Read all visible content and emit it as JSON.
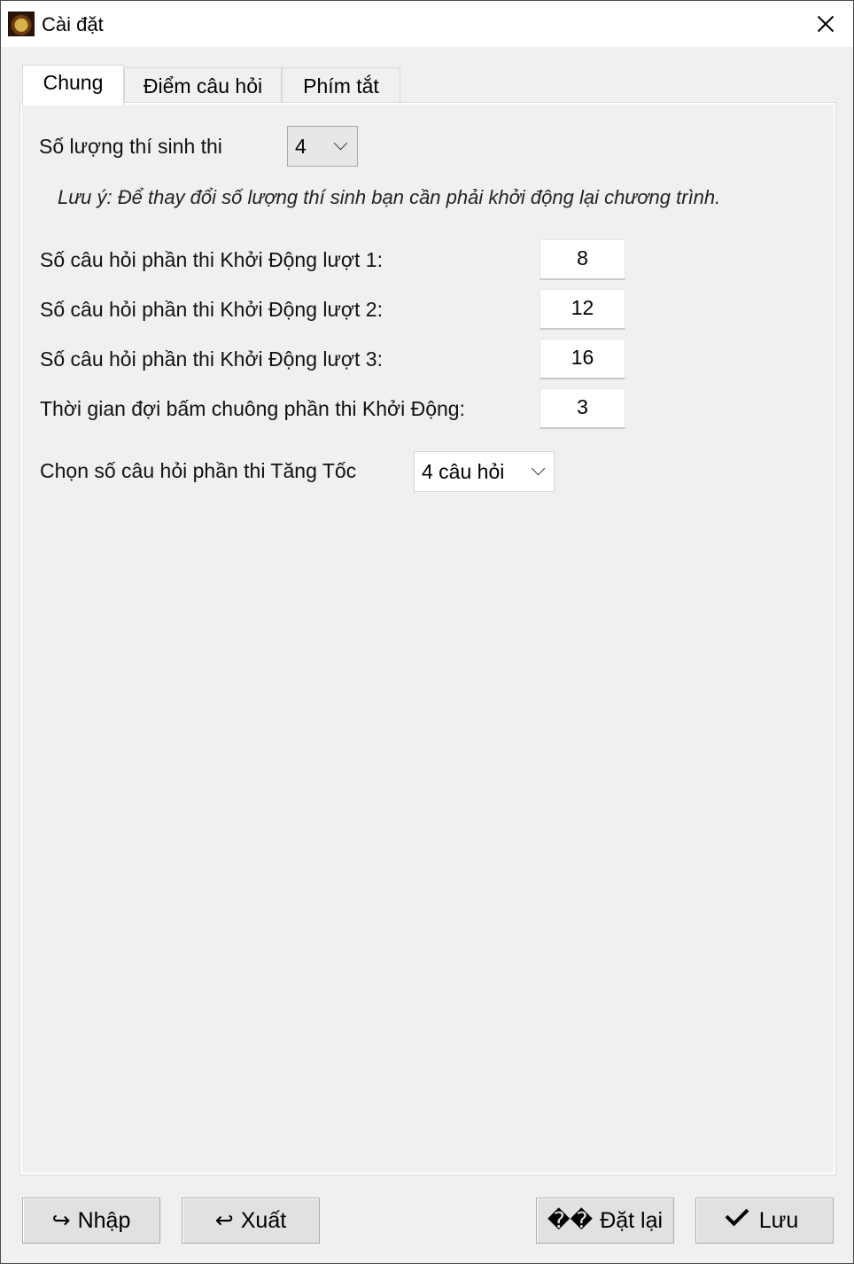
{
  "window": {
    "title": "Cài đặt"
  },
  "tabs": [
    {
      "label": "Chung",
      "active": true
    },
    {
      "label": "Điểm câu hỏi",
      "active": false
    },
    {
      "label": "Phím tắt",
      "active": false
    }
  ],
  "general": {
    "contestants_label": "Số lượng thí sinh thi",
    "contestants_value": "4",
    "note": "Lưu ý: Để thay đổi số lượng thí sinh bạn cần phải khởi động lại chương trình.",
    "fields": [
      {
        "label": "Số câu hỏi phần thi Khởi Động lượt 1:",
        "value": "8"
      },
      {
        "label": "Số câu hỏi phần thi Khởi Động lượt 2:",
        "value": "12"
      },
      {
        "label": "Số câu hỏi phần thi Khởi Động lượt 3:",
        "value": "16"
      },
      {
        "label": "Thời gian đợi bấm chuông phần thi Khởi Động:",
        "value": "3"
      }
    ],
    "acceleration_label": "Chọn số câu hỏi phần thi Tăng Tốc",
    "acceleration_value": "4 câu hỏi"
  },
  "footer": {
    "import_label": "Nhập",
    "import_icon": "↪",
    "export_label": "Xuất",
    "export_icon": "↩",
    "reset_icon": "��",
    "reset_label": "Đặt lại",
    "save_label": "Lưu"
  }
}
